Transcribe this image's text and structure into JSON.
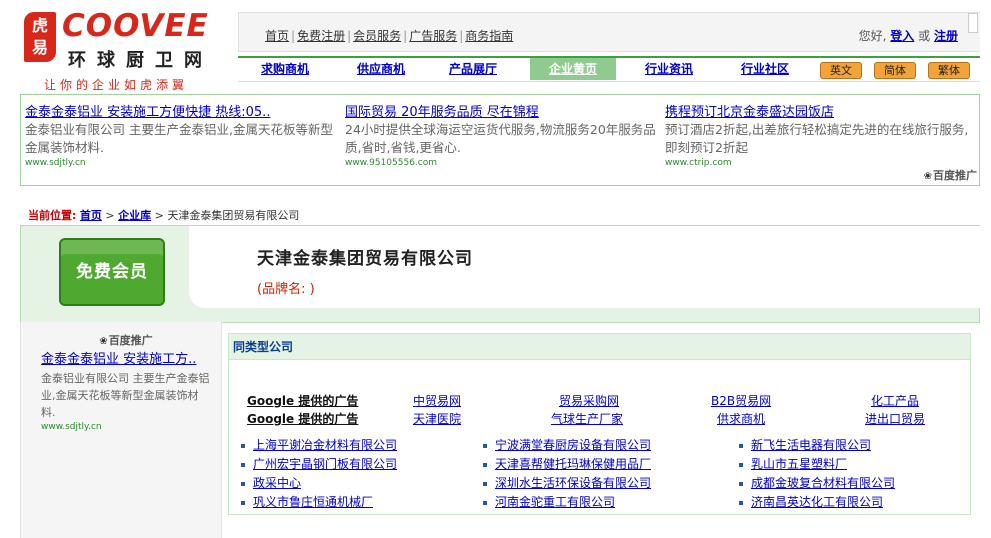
{
  "logo": {
    "badge": "虎\n易",
    "word": "COOVEE",
    "cn_name": "环球厨卫网",
    "slogan": "让你的企业如虎添翼"
  },
  "top_links": [
    "首页",
    "免费注册",
    "会员服务",
    "广告服务",
    "商务指南"
  ],
  "user_area": {
    "greeting": "您好,",
    "login": "登入",
    "or": "或",
    "register": "注册"
  },
  "nav": {
    "items": [
      "求购商机",
      "供应商机",
      "产品展厅",
      "企业黄页",
      "行业资讯",
      "行业社区"
    ],
    "active": "企业黄页",
    "lang": [
      "英文",
      "简体",
      "繁体"
    ]
  },
  "ad_strip": {
    "ads": [
      {
        "title": "金泰金泰铝业 安装施工方便快捷 热线:05..",
        "desc": "金泰铝业有限公司 主要生产金泰铝业,金属天花板等新型金属装饰材料.",
        "url": "www.sdjtly.cn"
      },
      {
        "title": "国际贸易 20年服务品质 尽在锦程",
        "desc": "24小时提供全球海运空运货代服务,物流服务20年服务品质,省时,省钱,更省心.",
        "url": "www.95105556.com"
      },
      {
        "title": "携程预订北京金泰盛达园饭店",
        "desc": "预订酒店2折起,出差旅行轻松搞定先进的在线旅行服务,即刻预订2折起",
        "url": "www.ctrip.com"
      }
    ],
    "baidu": "百度推广"
  },
  "breadcrumb": {
    "label": "当前位置:",
    "home": "首页",
    "lib": "企业库",
    "current": "天津金泰集团贸易有限公司"
  },
  "company": {
    "member_badge": "免费会员",
    "name": "天津金泰集团贸易有限公司",
    "brand": "(品牌名: )"
  },
  "left_ad": {
    "baidu": "百度推广",
    "title": "金泰金泰铝业 安装施工方..",
    "desc": "金泰铝业有限公司 主要生产金泰铝业,金属天花板等新型金属装饰材料.",
    "url": "www.sdjtly.cn"
  },
  "similar": {
    "heading": "同类型公司",
    "google_label": "Google 提供的广告",
    "ads_row1": [
      "中贸易网",
      "贸易采购网",
      "B2B贸易网",
      "化工产品"
    ],
    "ads_row2": [
      "天津医院",
      "气球生产厂家",
      "供求商机",
      "进出口贸易"
    ],
    "col1": [
      "上海平谢冶金材料有限公司",
      "广州宏宇晶钢门板有限公司",
      "政采中心",
      "巩义市鲁庄恒通机械厂"
    ],
    "col2": [
      "宁波满堂春厨房设备有限公司",
      "天津喜帮健托玛琳保健用品厂",
      "深圳水生活环保设备有限公司",
      "河南金驼重工有限公司"
    ],
    "col3": [
      "新飞生活电器有限公司",
      "乳山市五星塑料厂",
      "成都金玻复合材料有限公司",
      "济南昌英达化工有限公司"
    ]
  }
}
